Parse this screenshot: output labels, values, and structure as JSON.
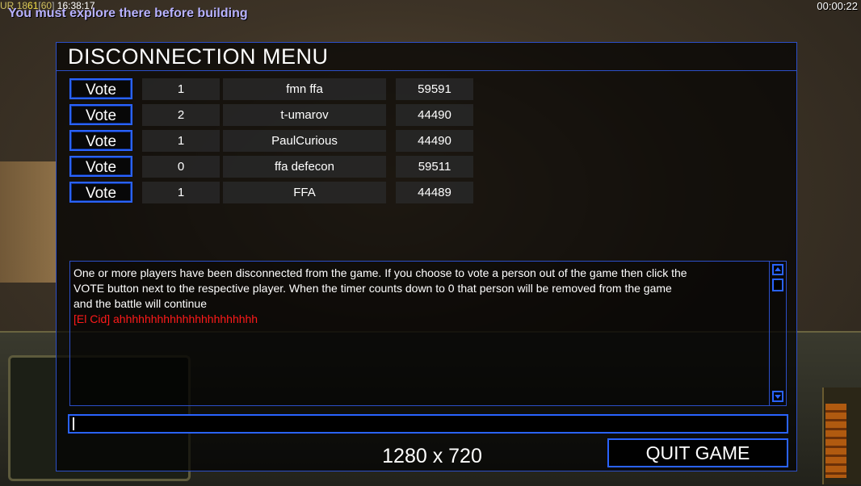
{
  "status_bar": {
    "code": "UR",
    "value_a": "18",
    "fps": "61",
    "fps_cap": "60",
    "clock": "16:38:17",
    "explore_message": "You must explore there before building",
    "game_timer": "00:00:22"
  },
  "dialog": {
    "title": "DISCONNECTION MENU",
    "players": [
      {
        "vote_label": "Vote",
        "votes": "1",
        "name": "fmn ffa",
        "ping": "59591"
      },
      {
        "vote_label": "Vote",
        "votes": "2",
        "name": "t-umarov",
        "ping": "44490"
      },
      {
        "vote_label": "Vote",
        "votes": "1",
        "name": "PaulCurious",
        "ping": "44490"
      },
      {
        "vote_label": "Vote",
        "votes": "0",
        "name": "ffa defecon",
        "ping": "59511"
      },
      {
        "vote_label": "Vote",
        "votes": "1",
        "name": "FFA",
        "ping": "44489"
      }
    ],
    "message_lines": [
      "One or more players have been disconnected from the game. If you choose to vote a person out of the game then click the",
      " VOTE button next to the respective player. When the timer counts down to 0 that person will be removed from the game",
      " and the battle will continue"
    ],
    "chat_line": "[El Cid] ahhhhhhhhhhhhhhhhhhhhhh",
    "chat_input_value": "",
    "resolution": "1280 x 720",
    "quit_label": "QUIT GAME"
  },
  "colors": {
    "accent_border": "#2a63ff",
    "chat_text": "#ff1a1a",
    "explore_text": "#b8b2ff"
  },
  "icons": {
    "scroll_up": "triangle-up",
    "scroll_down": "triangle-down"
  }
}
